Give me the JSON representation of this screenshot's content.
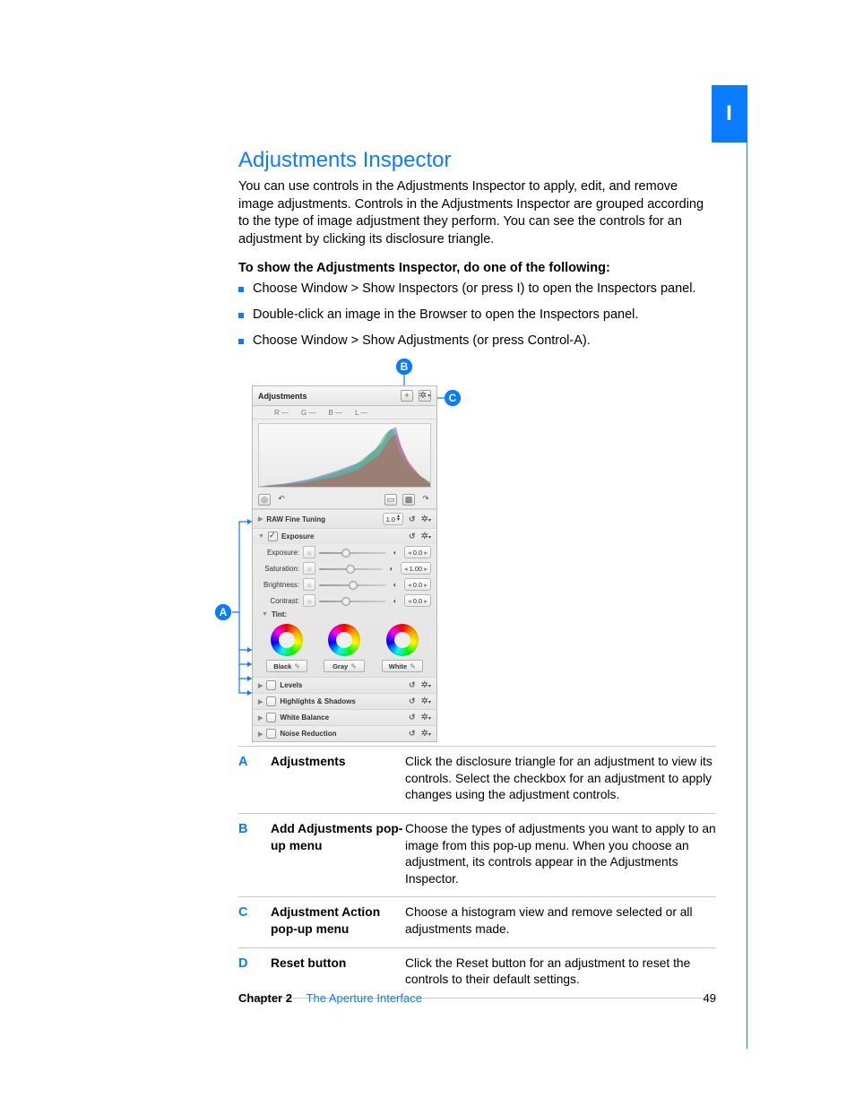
{
  "sideTab": "I",
  "title": "Adjustments Inspector",
  "intro": "You can use controls in the Adjustments Inspector to apply, edit, and remove image adjustments. Controls in the Adjustments Inspector are grouped according to the type of image adjustment they perform. You can see the controls for an adjustment by clicking its disclosure triangle.",
  "instructionsHeading": "To show the Adjustments Inspector, do one of the following:",
  "bullets": [
    "Choose Window > Show Inspectors (or press I) to open the Inspectors panel.",
    "Double-click an image in the Browser to open the Inspectors panel.",
    "Choose Window > Show Adjustments (or press Control-A)."
  ],
  "panel": {
    "title": "Adjustments",
    "channels": [
      "R",
      "G",
      "B",
      "L"
    ],
    "sections": {
      "rawFineTuning": {
        "label": "RAW Fine Tuning",
        "value": "1.0"
      },
      "exposure": {
        "label": "Exposure",
        "params": [
          {
            "key": "exposure",
            "label": "Exposure:",
            "value": "0.0",
            "pos": 40
          },
          {
            "key": "saturation",
            "label": "Saturation:",
            "value": "1.00",
            "pos": 50
          },
          {
            "key": "brightness",
            "label": "Brightness:",
            "value": "0.0",
            "pos": 50
          },
          {
            "key": "contrast",
            "label": "Contrast:",
            "value": "0.0",
            "pos": 40
          }
        ],
        "tintLabel": "Tint:",
        "tintButtons": [
          "Black",
          "Gray",
          "White"
        ]
      },
      "others": [
        "Levels",
        "Highlights & Shadows",
        "White Balance",
        "Noise Reduction"
      ]
    }
  },
  "callouts": [
    {
      "letter": "A",
      "name": "Adjustments",
      "desc": "Click the disclosure triangle for an adjustment to view its controls. Select the checkbox for an adjustment to apply changes using the adjustment controls."
    },
    {
      "letter": "B",
      "name": "Add Adjustments pop-up menu",
      "desc": "Choose the types of adjustments you want to apply to an image from this pop-up menu. When you choose an adjustment, its controls appear in the Adjustments Inspector."
    },
    {
      "letter": "C",
      "name": "Adjustment Action pop-up menu",
      "desc": "Choose a histogram view and remove selected or all adjustments made."
    },
    {
      "letter": "D",
      "name": "Reset button",
      "desc": "Click the Reset button for an adjustment to reset the controls to their default settings."
    }
  ],
  "footer": {
    "chapterLabel": "Chapter 2",
    "chapterTitle": "The Aperture Interface",
    "page": "49"
  }
}
